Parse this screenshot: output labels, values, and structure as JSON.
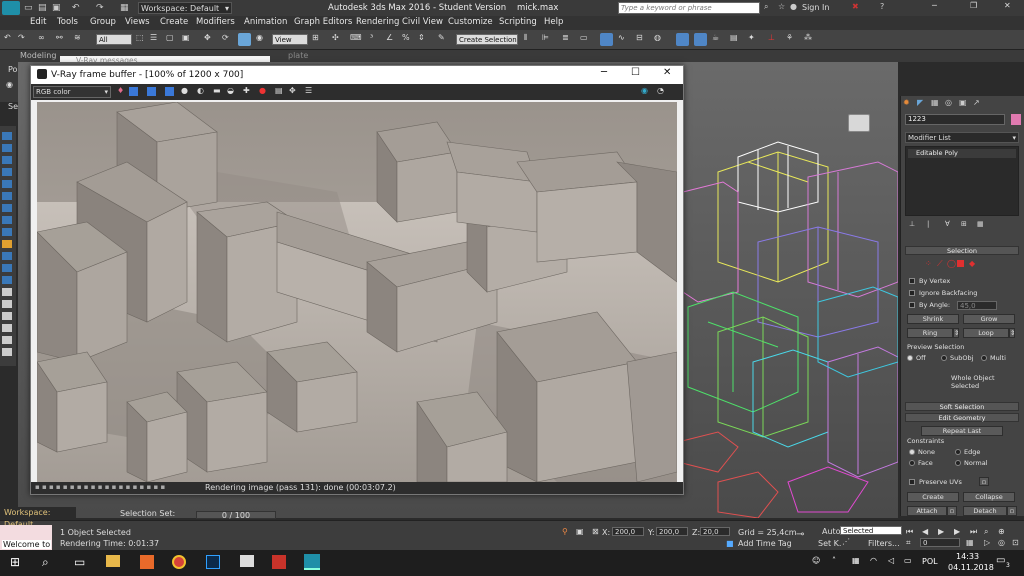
{
  "app": {
    "title": "Autodesk 3ds Max 2016 - Student Version    mick.max",
    "workspace": "Workspace: Default",
    "search_placeholder": "Type a keyword or phrase",
    "sign_in": "Sign In"
  },
  "menu": [
    "Edit",
    "Tools",
    "Group",
    "Views",
    "Create",
    "Modifiers",
    "Animation",
    "Graph Editors",
    "Rendering",
    "Civil View",
    "Customize",
    "Scripting",
    "Help"
  ],
  "toolbar": {
    "filter_all": "All",
    "view_label": "View",
    "selection_set": "Create Selection S"
  },
  "ribbon": {
    "modeling_tab": "Modeling",
    "polydraw": "PolyD",
    "select": "Select",
    "plate": "plate"
  },
  "vray_messages": "V-Ray messages",
  "vfb": {
    "title": "V-Ray frame buffer - [100% of 1200 x 700]",
    "channel": "RGB color",
    "status": "Rendering image (pass 131): done (00:03:07.2)"
  },
  "command_panel": {
    "object_name": "1223",
    "modifier_list": "Modifier List",
    "stack_item": "Editable Poly",
    "selection_header": "Selection",
    "by_vertex": "By Vertex",
    "ignore_backfacing": "Ignore Backfacing",
    "by_angle": "By Angle:",
    "by_angle_value": "45,0",
    "shrink": "Shrink",
    "grow": "Grow",
    "ring": "Ring",
    "loop": "Loop",
    "preview_selection": "Preview Selection",
    "preview_off": "Off",
    "preview_subobj": "SubObj",
    "preview_multi": "Multi",
    "whole_object_selected": "Whole Object Selected",
    "soft_selection": "Soft Selection",
    "edit_geometry": "Edit Geometry",
    "repeat_last": "Repeat Last",
    "constraints": "Constraints",
    "c_none": "None",
    "c_edge": "Edge",
    "c_face": "Face",
    "c_normal": "Normal",
    "preserve_uvs": "Preserve UVs",
    "create": "Create",
    "collapse": "Collapse",
    "attach": "Attach",
    "detach": "Detach"
  },
  "status": {
    "workspace": "Workspace: Default",
    "selection_set": "Selection Set:",
    "welcome": "Welcome to",
    "objects_selected": "1 Object Selected",
    "rendering_time": "Rendering Time: 0:01:37",
    "frame": "0 / 100",
    "x_label": "X:",
    "x_value": "200,0",
    "y_label": "Y:",
    "y_value": "200,0",
    "z_label": "Z:",
    "z_value": "20,0",
    "grid": "Grid = 25,4cm",
    "add_time_tag": "Add Time Tag",
    "auto": "Auto",
    "set_k": "Set K.",
    "selected": "Selected",
    "filters": "Filters...",
    "frame_field": "0"
  },
  "taskbar": {
    "time": "14:33",
    "date": "04.11.2018",
    "lang": "POL",
    "notifications": "3"
  }
}
